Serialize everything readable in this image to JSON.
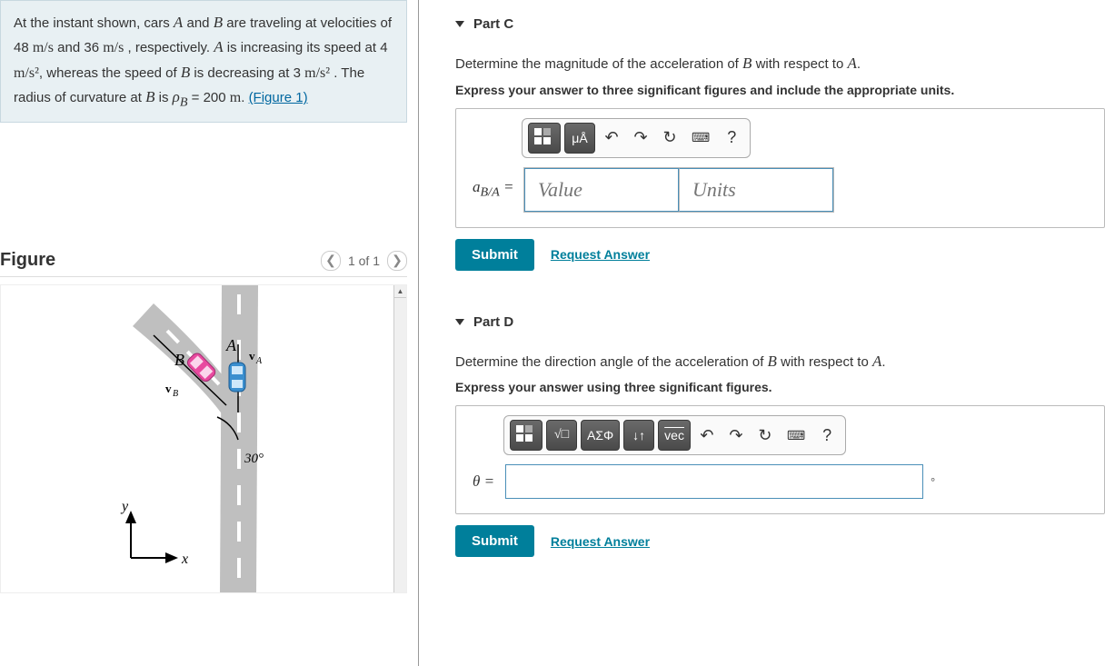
{
  "problem": {
    "pre": "At the instant shown, cars ",
    "vA": "A",
    "and1": " and ",
    "vB": "B",
    "mid1": " are traveling at velocities of 48 ",
    "u1": "m/s",
    "mid2": " and 36 ",
    "u2": "m/s",
    "mid3": " , respectively. ",
    "vA2": "A",
    "mid4": " is increasing its speed at 4 ",
    "u3": "m/s²",
    "mid5": ", whereas the speed of ",
    "vB2": "B",
    "mid6": " is decreasing at 3 ",
    "u4": "m/s²",
    "mid7": " . The radius of curvature at ",
    "vB3": "B",
    "mid8": " is ",
    "rho": "ρ_B",
    "mid9": " = 200 ",
    "u5": "m",
    "dot": ". ",
    "figlink": "(Figure 1)"
  },
  "figure": {
    "title": "Figure",
    "pager": "1 of 1",
    "labels": {
      "A": "A",
      "B": "B",
      "vA": "v_A",
      "vB": "v_B",
      "angle": "30°",
      "x": "x",
      "y": "y"
    }
  },
  "parts": [
    {
      "title": "Part C",
      "question_pre": "Determine the magnitude of the acceleration of ",
      "qB": "B",
      "question_mid": " with respect to ",
      "qA": "A",
      "question_end": ".",
      "hint": "Express your answer to three significant figures and include the appropriate units.",
      "var_label": "a_{B/A} =",
      "value_placeholder": "Value",
      "units_placeholder": "Units",
      "toolbar": {
        "mu": "μÅ",
        "help": "?"
      },
      "submit": "Submit",
      "request": "Request Answer"
    },
    {
      "title": "Part D",
      "question_pre": "Determine the direction angle of the acceleration of ",
      "qB": "B",
      "question_mid": " with respect to ",
      "qA": "A",
      "question_end": ".",
      "hint": "Express your answer using three significant figures.",
      "var_label": "θ =",
      "suffix": "°",
      "toolbar": {
        "greek": "ΑΣΦ",
        "updown": "↓↑",
        "vec": "vec",
        "help": "?"
      },
      "submit": "Submit",
      "request": "Request Answer"
    }
  ]
}
